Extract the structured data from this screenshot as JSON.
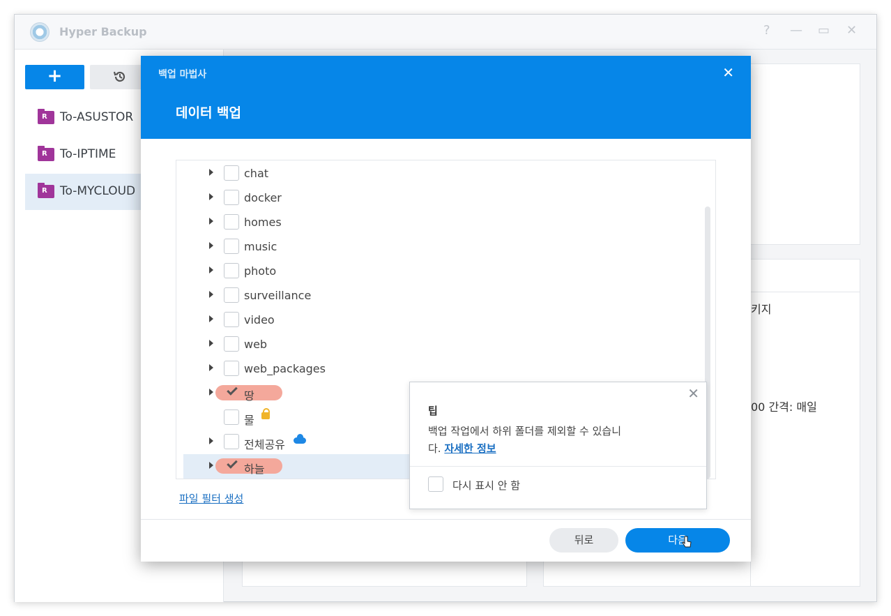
{
  "app": {
    "title": "Hyper Backup",
    "help": "?",
    "minimize": "—",
    "maximize": "▭",
    "close": "✕"
  },
  "sidebar": {
    "add_label": "+",
    "history_icon": "history-icon",
    "tasks": [
      {
        "label": "To-ASUSTOR"
      },
      {
        "label": "To-IPTIME"
      },
      {
        "label": "To-MYCLOUD"
      }
    ]
  },
  "background": {
    "text_package": "키지",
    "text_interval": "00 간격: 매일"
  },
  "modal": {
    "wizard_title": "백업 마법사",
    "title": "데이터 백업",
    "close": "✕",
    "folders": [
      {
        "name": "chat",
        "checked": false
      },
      {
        "name": "docker",
        "checked": false
      },
      {
        "name": "homes",
        "checked": false
      },
      {
        "name": "music",
        "checked": false
      },
      {
        "name": "photo",
        "checked": false
      },
      {
        "name": "surveillance",
        "checked": false
      },
      {
        "name": "video",
        "checked": false
      },
      {
        "name": "web",
        "checked": false
      },
      {
        "name": "web_packages",
        "checked": false
      },
      {
        "name": "땅",
        "checked": true
      },
      {
        "name": "물",
        "checked": false,
        "icon": "lock-icon"
      },
      {
        "name": "전체공유",
        "checked": false,
        "icon": "cloud-icon"
      },
      {
        "name": "하늘",
        "checked": true,
        "selected": true
      }
    ],
    "filter_link": "파일 필터 생성",
    "back_button": "뒤로",
    "next_button": "다음"
  },
  "tip": {
    "title": "팁",
    "body": "백업 작업에서 하위 폴더를 제외할 수 있습니다.",
    "body_line1": "백업 작업에서 하위 폴더를 제외할 수 있습니",
    "body_line2": "다. ",
    "link": "자세한 정보",
    "dont_show": "다시 표시 안 함",
    "close": "✕"
  },
  "colors": {
    "accent": "#0686e8",
    "highlight": "#f4a89b",
    "selected_row": "#e3edf7"
  }
}
